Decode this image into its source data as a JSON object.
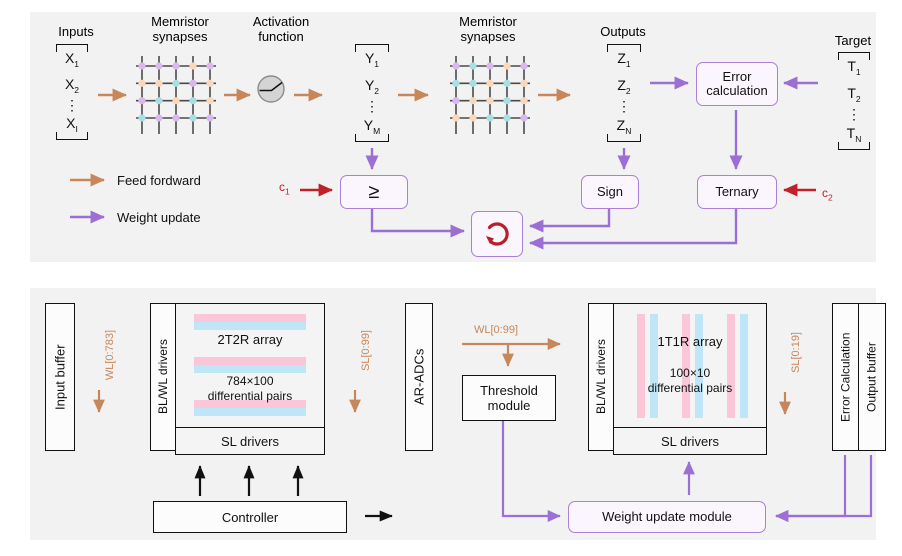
{
  "figure": {
    "title": "Memristor neural network training architecture",
    "colors": {
      "panel_bg": "#f2f2f2",
      "feed_forward": "#c8875a",
      "weight_update": "#9b6fd4",
      "constant_arrow": "#c0202a",
      "box_border_purple": "#a97fd8",
      "box_border_black": "#111111",
      "stripe_pink": "#fbc6d8",
      "stripe_blue": "#bfe6f7",
      "dot_purple": "#d9b8ef",
      "dot_orange": "#fbd8bb",
      "dot_cyan": "#a8dfe3"
    }
  },
  "top_panel": {
    "headings": {
      "inputs": "Inputs",
      "memristor_synapses_1": "Memristor\nsynapses",
      "activation_function": "Activation\nfunction",
      "memristor_synapses_2": "Memristor\nsynapses",
      "outputs": "Outputs",
      "target": "Target"
    },
    "vectors": {
      "x": {
        "items": [
          "X",
          "X",
          "⋮",
          "X"
        ],
        "subs": [
          "1",
          "2",
          "",
          "I"
        ]
      },
      "y": {
        "items": [
          "Y",
          "Y",
          "⋮",
          "Y"
        ],
        "subs": [
          "1",
          "2",
          "",
          "M"
        ]
      },
      "z": {
        "items": [
          "Z",
          "Z",
          "⋮",
          "Z"
        ],
        "subs": [
          "1",
          "2",
          "",
          "N"
        ]
      },
      "t": {
        "items": [
          "T",
          "T",
          "⋮",
          "T"
        ],
        "subs": [
          "1",
          "2",
          "",
          "N"
        ]
      }
    },
    "legend": [
      {
        "label": "Feed fordward",
        "color": "#c8875a",
        "icon": "arrow-right-icon"
      },
      {
        "label": "Weight update",
        "color": "#9b6fd4",
        "icon": "arrow-right-icon"
      }
    ],
    "blocks": {
      "error_calculation": "Error\ncalculation",
      "compare": "≥",
      "sign": "Sign",
      "ternary": "Ternary",
      "loop": "loop-refresh-icon"
    },
    "constants": {
      "c1": "c",
      "c1_sub": "1",
      "c2": "c",
      "c2_sub": "2"
    },
    "activation_icon": "relu-activation-icon"
  },
  "bottom_panel": {
    "blocks": {
      "input_buffer": "Input buffer",
      "blwl_drivers_left": "BL/WL drivers",
      "sl_drivers_left": "SL drivers",
      "array_left_title": "2T2R array",
      "array_left_size": "784×100",
      "array_left_sub": "differential pairs",
      "ar_adcs": "AR-ADCs",
      "threshold_module": "Threshold\nmodule",
      "blwl_drivers_right": "BL/WL drivers",
      "sl_drivers_right": "SL drivers",
      "array_right_title": "1T1R array",
      "array_right_size": "100×10",
      "array_right_sub": "differential pairs",
      "error_calculation": "Error Calculation",
      "output_buffer": "Output buffer",
      "controller": "Controller",
      "weight_update_module": "Weight update module"
    },
    "signals": {
      "wl_0_783": "WL[0:783]",
      "sl_0_99": "SL[0:99]",
      "wl_0_99": "WL[0:99]",
      "sl_0_19": "SL[0:19]"
    }
  }
}
